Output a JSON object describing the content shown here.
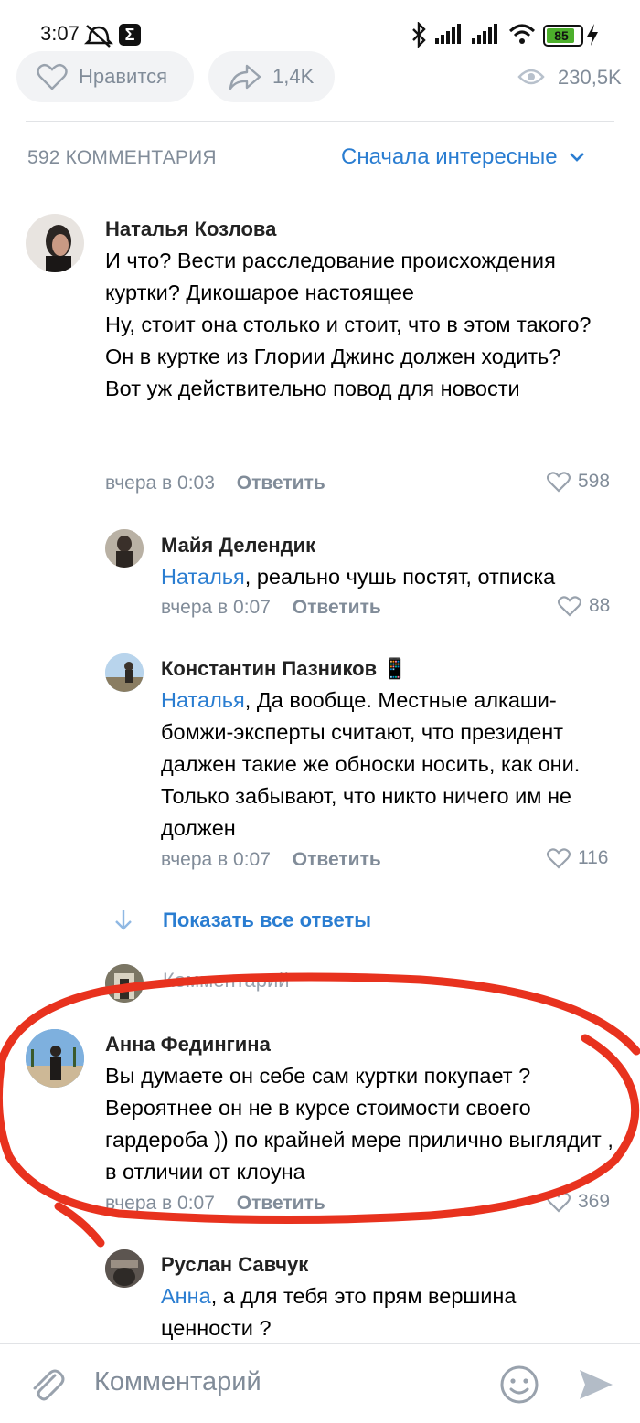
{
  "status_bar": {
    "time": "3:07",
    "battery": "85"
  },
  "actions": {
    "like_label": "Нравится",
    "share_count": "1,4K",
    "views": "230,5K"
  },
  "comments_header": {
    "count_label": "592 КОММЕНТАРИЯ",
    "sort_label": "Сначала интересные"
  },
  "comments": [
    {
      "author": "Наталья Козлова",
      "text": "И что? Вести расследование происхождения куртки? Дикошарое настоящее\nНу, стоит она столько и стоит, что в этом такого? Он в куртке из Глории Джинс должен ходить? Вот уж действительно повод для новости",
      "time": "вчера в 0:03",
      "reply": "Ответить",
      "likes": "598"
    },
    {
      "author": "Майя Делендик",
      "mention": "Наталья",
      "text": ", реально чушь постят, отписка",
      "time": "вчера в 0:07",
      "reply": "Ответить",
      "likes": "88"
    },
    {
      "author": "Константин Пазников 📱",
      "mention": "Наталья",
      "text": ", Да вообще. Местные алкаши- бомжи-эксперты считают, что президент далжен такие же обноски носить, как они. Только забывают, что никто ничего им не должен",
      "time": "вчера в 0:07",
      "reply": "Ответить",
      "likes": "116"
    },
    {
      "author": "Анна Федингина",
      "text": "Вы думаете он себе сам куртки покупает ? Вероятнее он не в курсе стоимости своего гардероба )) по крайней мере прилично выглядит , в отличии от клоуна",
      "time": "вчера в 0:07",
      "reply": "Ответить",
      "likes": "369"
    },
    {
      "author": "Руслан Савчук",
      "mention": "Анна",
      "text": ", а для тебя это прям вершина ценности ?"
    }
  ],
  "show_all_replies": "Показать все ответы",
  "inline_reply_placeholder": "Комментарий",
  "input": {
    "placeholder": "Комментарий"
  },
  "colors": {
    "accent": "#2a7dd1",
    "secondary": "#818c99",
    "annotation": "#e8321e"
  }
}
